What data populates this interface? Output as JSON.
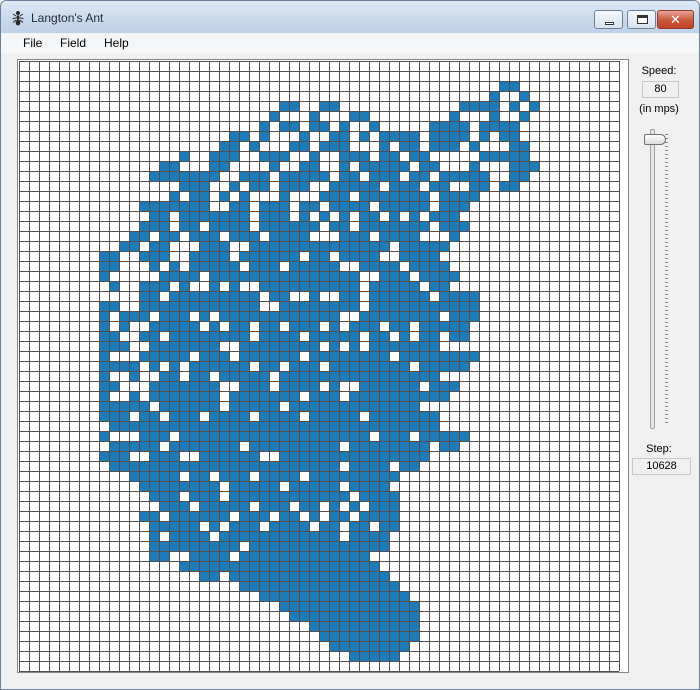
{
  "window": {
    "title": "Langton's Ant",
    "close_symbol": "✕",
    "icon": "ant-icon"
  },
  "menu": {
    "file": "File",
    "field": "Field",
    "help": "Help"
  },
  "colors": {
    "grid_line": "#505050",
    "cell_on": "#1f7ab8",
    "cell_off": "#ffffff"
  },
  "controls": {
    "speed_label": "Speed:",
    "speed_value": "80",
    "speed_unit": "(in mps)",
    "speed_slider_fraction": 0.02,
    "step_label": "Step:",
    "step_value": "10628"
  },
  "grid": {
    "cols": 60,
    "rows": 61,
    "filled_rows": [
      "",
      "",
      "48,49",
      "47,50",
      "26,27,30,31,44,45,46,47,49,51",
      "25,29,33,34,43,47,50",
      "24,26,27,29,30,32,35,41,42,43,44,46,47,48,49",
      "21,22,24,28,31,32,34,36,37,38,39,41,42,43,44,46,48,49",
      "20,21,23,27,28,30,31,32,36,38,39,41,42,43,45,49,50",
      "16,19,20,21,24,25,26,29,32,33,34,36,37,39,40,46,47,48,49,50",
      "14,15,19,20,25,28,29,32,34,35,36,37,38,40,41,45,49,50,51",
      "13,14,15,16,17,18,19,22,23,24,26,27,28,29,30,32,33,35,36,37,39,40,42,43,44,45,46,49,50",
      "16,17,18,21,23,24,26,27,28,31,32,33,34,35,37,38,39,41,42,45,46,48,49",
      "15,17,18,20,22,26,30,31,32,34,35,36,37,38,39,40,42,43,44,45",
      "12,13,14,15,16,17,18,21,22,24,25,26,28,29,31,32,33,34,36,37,38,39,40,42,43,44",
      "13,14,16,17,18,19,20,21,22,24,25,26,28,30,32,34,35,37,39,41,42,43",
      "12,13,14,16,17,19,20,21,22,24,25,26,27,28,29,31,32,34,35,36,37,38,39,40,42,43,44",
      "11,12,14,15,17,18,19,21,22,23,25,26,27,28,32,33,34,36,37,38,39,43",
      "10,11,13,14,18,19,20,23,24,25,26,27,28,29,30,31,32,33,34,35,36,38,39,40,41,42",
      "8,9,12,13,14,17,18,19,20,22,23,24,25,26,27,29,30,32,33,34,35,38,39,40,41",
      "8,9,13,15,17,18,19,20,21,23,24,25,27,28,29,30,31,34,35,36,37,39,40,41,42",
      "8,14,15,16,17,19,20,21,22,23,24,25,26,27,28,29,30,31,32,33,36,37,38,40,41,42,43",
      "9,12,13,14,16,19,21,24,25,26,27,28,29,30,31,32,33,35,36,37,38,39,41,42",
      "12,13,15,16,17,18,19,20,21,22,23,25,26,29,32,33,35,36,37,38,39,40,42,43,44,45",
      "8,9,12,13,14,15,16,17,18,19,20,21,22,23,26,27,28,29,30,31,32,33,35,36,37,38,39,40,41,42,43,44,45",
      "8,10,11,12,14,15,16,18,20,21,22,23,24,25,26,27,28,29,30,31,34,35,36,37,38,39,40,41,43,44,45",
      "8,10,13,14,15,16,17,19,21,22,24,25,27,28,29,31,33,34,35,37,38,40,41,42,43,44",
      "8,9,12,13,15,16,17,18,19,20,21,22,24,25,26,27,29,30,31,32,33,35,36,38,40,41,43,44",
      "8,9,10,13,14,15,16,17,18,19,22,23,24,25,26,27,28,29,31,33,35,36,37,38,39,40,41",
      "8,12,13,14,15,16,18,19,20,22,23,24,25,26,27,29,30,31,32,33,34,35,36,38,39,40,41,42,43,44,45",
      "8,9,10,11,13,15,17,18,19,20,21,22,24,25,27,28,29,31,32,33,34,35,36,37,38,40,41,42,43,44",
      "8,11,14,15,17,18,20,21,22,23,24,26,27,28,29,30,31,32,33,34,35,36,37,38,39,40,41",
      "8,9,13,14,15,16,17,18,19,22,23,24,26,27,28,29,31,34,35,36,37,38,39,41,42,43",
      "8,11,13,14,15,16,17,18,19,21,22,23,24,25,26,27,29,30,31,33,34,35,36,37,38,39,40,41,42",
      "8,9,10,11,12,14,15,16,17,18,19,21,22,23,24,25,27,28,29,30,31,32,33,34,35,36,37,38,39",
      "8,9,10,12,13,15,16,17,19,20,21,22,24,25,26,27,29,30,31,32,33,35,36,37,38,39,40,41",
      "9,10,11,12,13,14,15,16,17,18,19,20,21,22,23,24,25,26,27,28,29,30,31,32,33,34,35,36,37,38,39,40,41",
      "8,12,13,14,16,17,18,19,20,21,22,23,24,25,26,27,28,29,30,31,32,33,34,36,37,38,40,41,42,43,44",
      "9,10,11,12,13,15,16,17,18,19,20,21,23,24,25,26,27,28,29,30,31,33,34,35,36,37,38,39,40,42,43",
      "8,9,10,13,14,15,18,19,20,21,22,23,26,27,28,29,30,31,32,33,34,35,36,37,38,39,40",
      "9,10,11,12,13,14,15,16,17,18,19,20,21,22,23,24,25,26,27,28,29,30,31,33,34,35,36,38,39",
      "11,12,13,14,15,17,18,20,21,22,24,25,26,27,29,30,31,32,33,34,35,36,37",
      "12,13,14,15,16,17,18,19,21,22,23,24,25,27,28,29,30,31,33,34,35,36",
      "13,14,15,17,18,19,21,22,23,24,25,26,27,28,29,30,31,32,34,35,36,37",
      "14,15,16,18,19,20,21,22,24,25,26,28,29,31,33,35,36,37",
      "12,13,15,16,17,18,19,20,22,23,24,26,27,29,31,32,34,35,36,37",
      "13,14,15,16,17,19,21,22,23,25,26,27,28,30,31,33,34,36,37",
      "13,15,16,17,18,20,21,22,23,24,25,26,27,28,29,30,31,33,34,35,36",
      "13,14,15,16,17,18,19,20,21,23,24,25,26,27,28,29,30,31,32,33,34,35,36",
      "13,14,17,18,19,20,22,23,24,25,26,27,28,29,30,31,32,33,34",
      "16,17,18,19,20,21,22,23,24,25,26,27,28,29,30,31,32,33,34,35",
      "18,19,21,22,23,24,25,26,27,28,29,30,31,32,33,34,35,36",
      "22,23,24,25,26,27,28,29,30,31,32,33,34,35,36,37",
      "24,25,26,27,28,29,30,31,32,33,34,35,36,37,38",
      "26,27,28,29,30,31,32,33,34,35,36,37,38,39",
      "27,28,29,30,31,32,33,34,35,36,37,38,39",
      "29,30,31,32,33,34,35,36,37,38,39",
      "30,31,32,33,34,35,36,37,38,39",
      "31,32,33,34,35,36,37,38",
      "33,34,35,36,37",
      "",
      ""
    ]
  }
}
